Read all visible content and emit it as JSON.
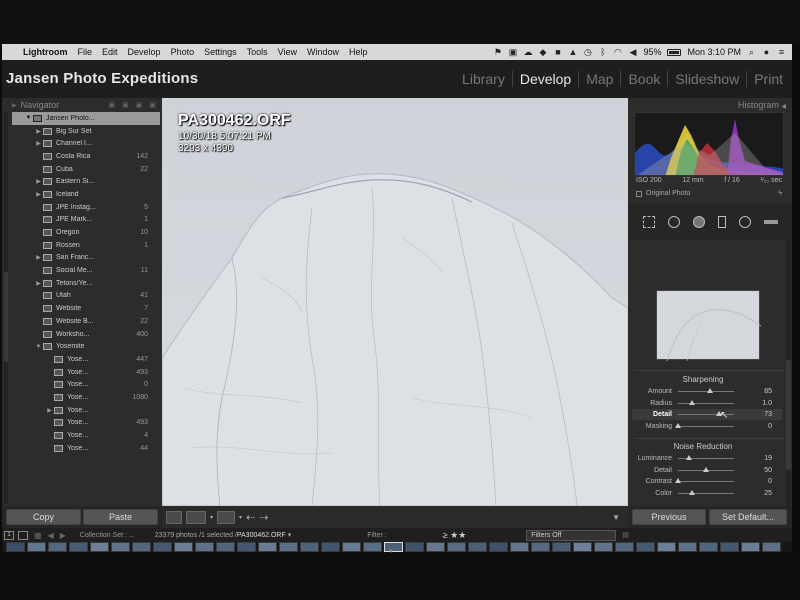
{
  "menubar": {
    "app_name": "Lightroom",
    "items": [
      "File",
      "Edit",
      "Develop",
      "Photo",
      "Settings",
      "Tools",
      "View",
      "Window",
      "Help"
    ],
    "battery": "95%",
    "clock": "Mon 3:10 PM"
  },
  "identity_plate": "Jansen Photo Expeditions",
  "modules": [
    "Library",
    "Develop",
    "Map",
    "Book",
    "Slideshow",
    "Print"
  ],
  "active_module": "Develop",
  "left_panel": {
    "navigator_label": "Navigator",
    "folders": [
      {
        "name": "Jansen Photo...",
        "count": "",
        "level": 0,
        "tri": "▼",
        "selected": true
      },
      {
        "name": "Big Sur Set",
        "count": "",
        "level": 1,
        "tri": "▶"
      },
      {
        "name": "Channel I...",
        "count": "",
        "level": 1,
        "tri": "▶"
      },
      {
        "name": "Costa Rica",
        "count": "142",
        "level": 1,
        "tri": ""
      },
      {
        "name": "Cuba",
        "count": "22",
        "level": 1,
        "tri": ""
      },
      {
        "name": "Eastern Si...",
        "count": "",
        "level": 1,
        "tri": "▶"
      },
      {
        "name": "Iceland",
        "count": "",
        "level": 1,
        "tri": "▶"
      },
      {
        "name": "JPE Instag...",
        "count": "5",
        "level": 1,
        "tri": ""
      },
      {
        "name": "JPE Mark...",
        "count": "1",
        "level": 1,
        "tri": ""
      },
      {
        "name": "Oregon",
        "count": "10",
        "level": 1,
        "tri": ""
      },
      {
        "name": "Rossen",
        "count": "1",
        "level": 1,
        "tri": ""
      },
      {
        "name": "San Franc...",
        "count": "",
        "level": 1,
        "tri": "▶"
      },
      {
        "name": "Social Me...",
        "count": "11",
        "level": 1,
        "tri": ""
      },
      {
        "name": "Tetons/Ye...",
        "count": "",
        "level": 1,
        "tri": "▶"
      },
      {
        "name": "Utah",
        "count": "41",
        "level": 1,
        "tri": ""
      },
      {
        "name": "Website",
        "count": "7",
        "level": 1,
        "tri": ""
      },
      {
        "name": "Website B...",
        "count": "22",
        "level": 1,
        "tri": ""
      },
      {
        "name": "Worksho...",
        "count": "400",
        "level": 1,
        "tri": ""
      },
      {
        "name": "Yosemite",
        "count": "",
        "level": 1,
        "tri": "▼"
      },
      {
        "name": "Yose...",
        "count": "447",
        "level": 2,
        "tri": ""
      },
      {
        "name": "Yose...",
        "count": "493",
        "level": 2,
        "tri": ""
      },
      {
        "name": "Yose...",
        "count": "0",
        "level": 2,
        "tri": ""
      },
      {
        "name": "Yose...",
        "count": "1080",
        "level": 2,
        "tri": ""
      },
      {
        "name": "Yose...",
        "count": "",
        "level": 2,
        "tri": "▶"
      },
      {
        "name": "Yose...",
        "count": "493",
        "level": 2,
        "tri": ""
      },
      {
        "name": "Yose...",
        "count": "4",
        "level": 2,
        "tri": ""
      },
      {
        "name": "Yose...",
        "count": "44",
        "level": 2,
        "tri": ""
      }
    ],
    "copy_label": "Copy",
    "paste_label": "Paste"
  },
  "photo": {
    "filename": "PA300462.ORF",
    "datetime": "10/30/18 5:07:21 PM",
    "dimensions": "3293 x 4390"
  },
  "right_panel": {
    "histogram_label": "Histogram",
    "exif": {
      "iso": "ISO 200",
      "focal": "12 mm",
      "aperture": "f / 16",
      "shutter": "¹⁄₁₀ sec"
    },
    "original_photo_label": "Original Photo",
    "sharpening": {
      "title": "Sharpening",
      "sliders": [
        {
          "label": "Amount",
          "value": "85",
          "fraction": 0.57
        },
        {
          "label": "Radius",
          "value": "1.0",
          "fraction": 0.25
        },
        {
          "label": "Detail",
          "value": "73",
          "fraction": 0.73,
          "active": true
        },
        {
          "label": "Masking",
          "value": "0",
          "fraction": 0.0
        }
      ]
    },
    "noise_reduction": {
      "title": "Noise Reduction",
      "sliders": [
        {
          "label": "Luminance",
          "value": "19",
          "fraction": 0.19
        },
        {
          "label": "Detail",
          "value": "50",
          "fraction": 0.5
        },
        {
          "label": "Contrast",
          "value": "0",
          "fraction": 0.0
        },
        {
          "label": "Color",
          "value": "25",
          "fraction": 0.25
        }
      ]
    },
    "previous_label": "Previous",
    "set_default_label": "Set Default..."
  },
  "filmstrip_bar": {
    "page_1": "1",
    "collection": "Collection Set : ...",
    "photo_count": "23379 photos /1 selected /",
    "selected_file": "PA300462.ORF",
    "filter_label": "Filter :",
    "rating": "≥ ★★",
    "filters_off": "Filters Off"
  },
  "colors": {
    "panel_bg": "#2c2c2c",
    "menubar_bg": "#d8d8d8",
    "photo_bg": "#d4d7dc",
    "selected_folder": "#9a9a9a"
  }
}
